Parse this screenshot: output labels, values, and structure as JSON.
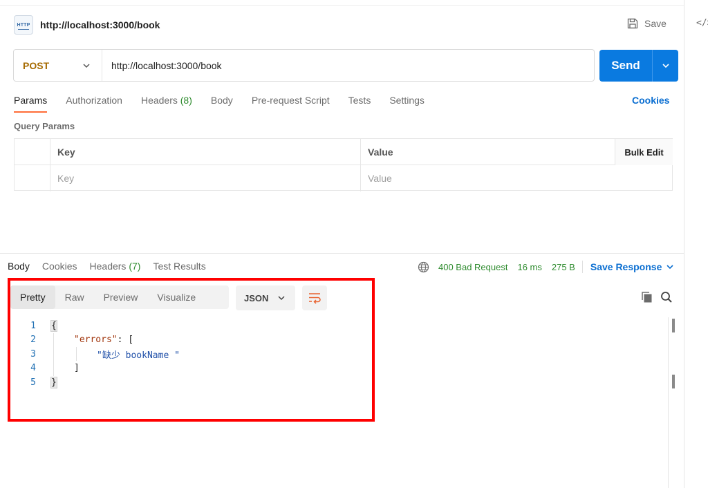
{
  "request": {
    "title": "http://localhost:3000/book",
    "badge": "HTTP",
    "save_label": "Save",
    "method": "POST",
    "url": "http://localhost:3000/book",
    "send_label": "Send",
    "tabs": [
      {
        "label": "Params",
        "count": "",
        "active": true
      },
      {
        "label": "Authorization",
        "count": "",
        "active": false
      },
      {
        "label": "Headers",
        "count": "(8)",
        "active": false
      },
      {
        "label": "Body",
        "count": "",
        "active": false
      },
      {
        "label": "Pre-request Script",
        "count": "",
        "active": false
      },
      {
        "label": "Tests",
        "count": "",
        "active": false
      },
      {
        "label": "Settings",
        "count": "",
        "active": false
      }
    ],
    "cookies_label": "Cookies",
    "query_params_label": "Query Params",
    "table": {
      "headers": [
        "Key",
        "Value",
        "Bulk Edit"
      ],
      "key_placeholder": "Key",
      "value_placeholder": "Value"
    }
  },
  "response": {
    "tabs": [
      {
        "label": "Body",
        "count": "",
        "active": true
      },
      {
        "label": "Cookies",
        "count": "",
        "active": false
      },
      {
        "label": "Headers",
        "count": "(7)",
        "active": false
      },
      {
        "label": "Test Results",
        "count": "",
        "active": false
      }
    ],
    "status": "400 Bad Request",
    "time": "16 ms",
    "size": "275 B",
    "save_response_label": "Save Response",
    "view_tabs": [
      "Pretty",
      "Raw",
      "Preview",
      "Visualize"
    ],
    "active_view": "Pretty",
    "format": "JSON",
    "code_lines": [
      {
        "num": "1",
        "text": "{"
      },
      {
        "num": "2",
        "key": "\"errors\"",
        "rest": ": ["
      },
      {
        "num": "3",
        "value": "\"缺少 bookName \""
      },
      {
        "num": "4",
        "text": "]"
      },
      {
        "num": "5",
        "text": "}"
      }
    ]
  },
  "side_panel": {
    "code_icon": "</>"
  },
  "colors": {
    "accent_orange": "#ff6c37",
    "send_blue": "#0a7ae0",
    "link_blue": "#0a6ed1",
    "status_green": "#2e8b2e",
    "method_post": "#a56a00",
    "highlight_red": "#ff0000"
  }
}
